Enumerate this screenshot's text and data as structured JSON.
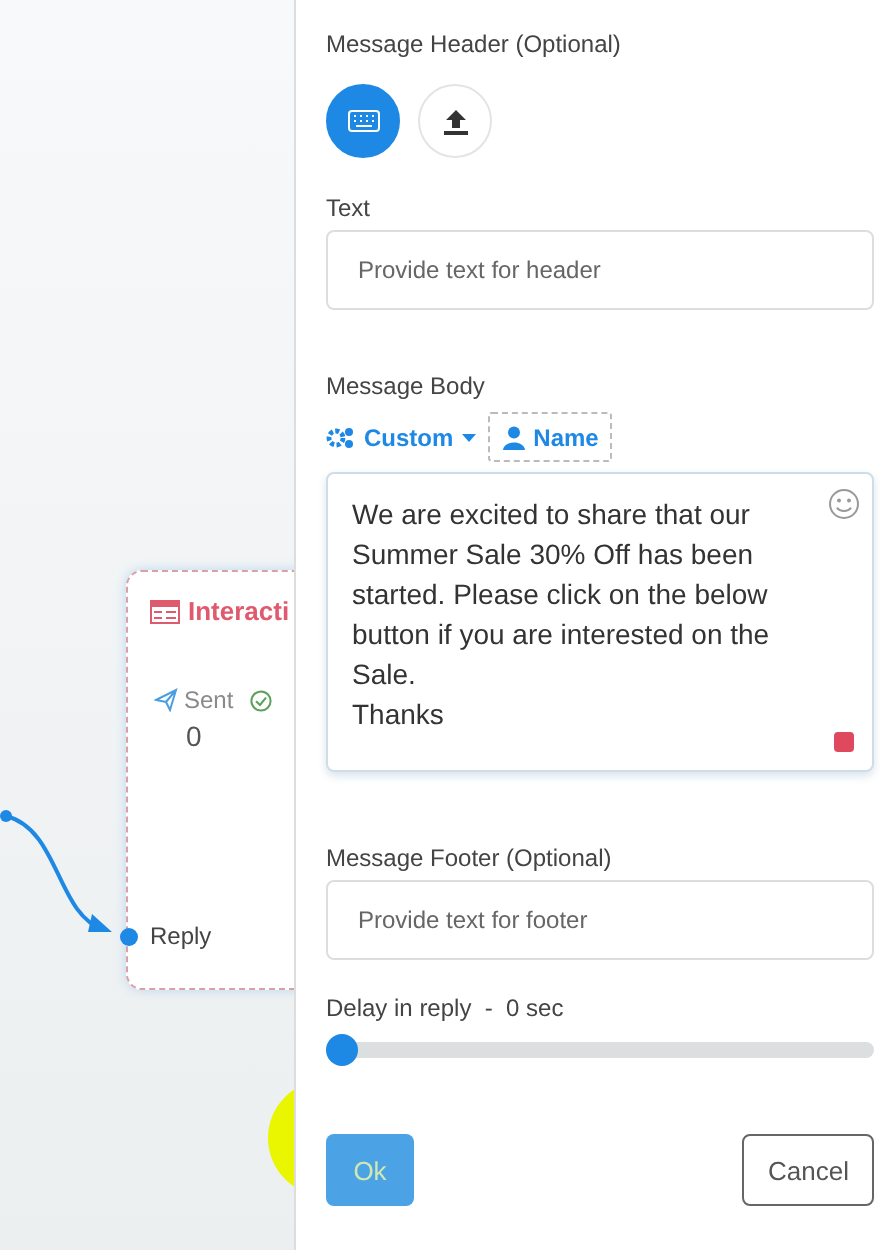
{
  "canvas": {
    "node": {
      "title": "Interacti",
      "stats": [
        {
          "label": "Sent",
          "value": "0"
        }
      ],
      "port": "Reply"
    }
  },
  "panel": {
    "header": {
      "label": "Message Header (Optional)",
      "types": [
        {
          "kind": "keyboard",
          "selected": true
        },
        {
          "kind": "upload",
          "selected": false
        }
      ]
    },
    "text_field": {
      "label": "Text",
      "placeholder": "Provide text for header"
    },
    "body": {
      "label": "Message Body",
      "custom": "Custom",
      "name": "Name",
      "value": "We are excited to share that our Summer Sale 30% Off has been started. Please click on the below button if you are interested on the Sale.\nThanks"
    },
    "footer": {
      "label": "Message Footer (Optional)",
      "placeholder": "Provide text for footer"
    },
    "delay": {
      "label": "Delay in reply  -  0 sec",
      "level": 0
    },
    "buttons": [
      {
        "kind": "primary",
        "label": "Ok"
      },
      {
        "kind": "secondary",
        "label": "Cancel"
      }
    ]
  }
}
